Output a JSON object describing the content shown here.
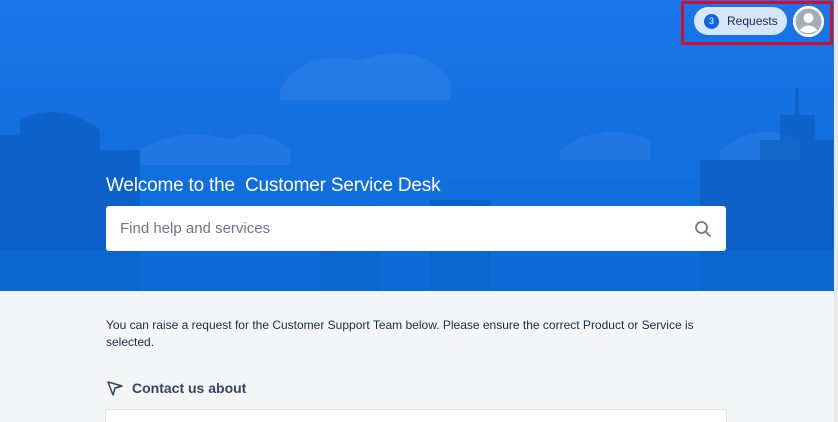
{
  "header": {
    "requests_count": "3",
    "requests_label": "Requests"
  },
  "hero": {
    "welcome_prefix": "Welcome to the",
    "portal_name": "Customer Service Desk"
  },
  "search": {
    "placeholder": "Find help and services",
    "value": ""
  },
  "main": {
    "info_text": "You can raise a request for the Customer Support Team below. Please ensure the correct Product or Service is selected.",
    "contact_label": "Contact us about"
  },
  "icons": {
    "search": "search-icon",
    "avatar": "user-avatar-icon",
    "contact": "send-icon"
  },
  "colors": {
    "hero": "#0d6ad9",
    "badge": "#0c66e4",
    "highlight": "#d0102a"
  }
}
